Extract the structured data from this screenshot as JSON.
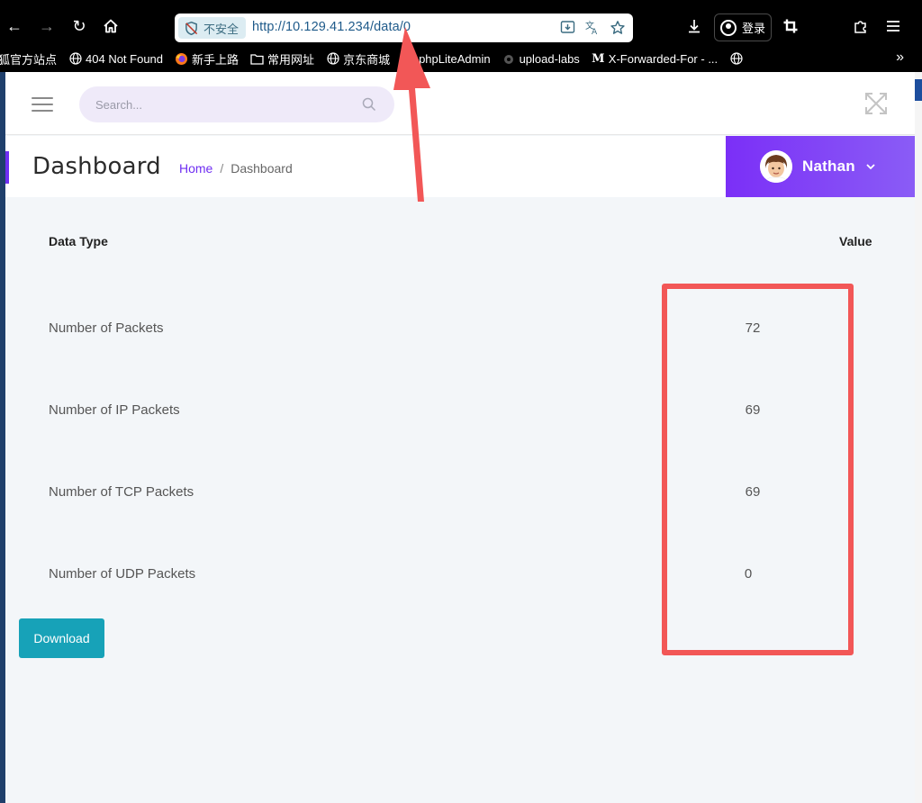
{
  "browser": {
    "security_label": "不安全",
    "url": "http://10.129.41.234/data/0",
    "login_label": "登录",
    "bookmarks": [
      {
        "label": "狐官方站点",
        "icon": "none"
      },
      {
        "label": "404 Not Found",
        "icon": "globe-icon"
      },
      {
        "label": "新手上路",
        "icon": "firefox-icon"
      },
      {
        "label": "常用网址",
        "icon": "folder-icon"
      },
      {
        "label": "京东商城",
        "icon": "globe-icon"
      },
      {
        "label": "phpLiteAdmin",
        "icon": "globe-icon"
      },
      {
        "label": "upload-labs",
        "icon": "site-icon"
      },
      {
        "label": "X-Forwarded-For - ...",
        "icon": "medium-icon"
      },
      {
        "label": "",
        "icon": "globe-icon"
      }
    ]
  },
  "header": {
    "search_placeholder": "Search..."
  },
  "subheader": {
    "title": "Dashboard",
    "breadcrumb": {
      "home": "Home",
      "separator": "/",
      "current": "Dashboard"
    },
    "user_name": "Nathan"
  },
  "table": {
    "col_type": "Data Type",
    "col_value": "Value",
    "rows": [
      {
        "label": "Number of Packets",
        "value": "72"
      },
      {
        "label": "Number of IP Packets",
        "value": "69"
      },
      {
        "label": "Number of TCP Packets",
        "value": "69"
      },
      {
        "label": "Number of UDP Packets",
        "value": "0"
      }
    ]
  },
  "download_label": "Download",
  "annotation_colors": {
    "highlight": "#f25757",
    "arrow": "#f25757"
  }
}
